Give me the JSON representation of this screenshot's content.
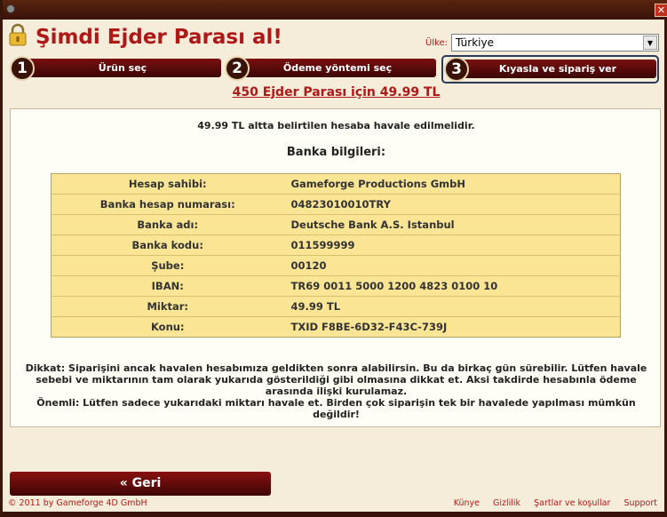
{
  "header": {
    "title": "Şimdi Ejder Parası al!",
    "country_label": "Ülke:",
    "country_value": "Türkiye"
  },
  "steps": [
    {
      "num": "1",
      "label": "Ürün seç"
    },
    {
      "num": "2",
      "label": "Ödeme yöntemi seç"
    },
    {
      "num": "3",
      "label": "Kıyasla ve sipariş ver"
    }
  ],
  "headline": "450 Ejder Parası için 49.99 TL",
  "panel": {
    "info": "49.99 TL altta belirtilen hesaba havale edilmelidir.",
    "bank_title": "Banka bilgileri:",
    "rows": [
      {
        "key": "Hesap sahibi:",
        "value": "Gameforge Productions GmbH"
      },
      {
        "key": "Banka hesap numarası:",
        "value": "04823010010TRY"
      },
      {
        "key": "Banka adı:",
        "value": "Deutsche Bank A.S. Istanbul"
      },
      {
        "key": "Banka kodu:",
        "value": "011599999"
      },
      {
        "key": "Şube:",
        "value": "00120"
      },
      {
        "key": "IBAN:",
        "value": "TR69 0011 5000 1200 4823 0100 10"
      },
      {
        "key": "Miktar:",
        "value": "49.99 TL"
      },
      {
        "key": "Konu:",
        "value": "TXID F8BE-6D32-F43C-739J"
      }
    ],
    "notice_1": "Dikkat: Siparişini ancak havalen hesabımıza geldikten sonra alabilirsin. Bu da birkaç gün sürebilir. Lütfen havale sebebi ve miktarının tam olarak yukarıda gösterildiği gibi olmasına dikkat et. Aksi takdirde hesabınla ödeme arasında ilişki kurulamaz.",
    "notice_2": "Önemli: Lütfen sadece yukarıdaki miktarı havale et. Birden çok siparişin tek bir havalede yapılması mümkün değildir!"
  },
  "back_label": "« Geri",
  "footer": {
    "copyright": "© 2011 by Gameforge 4D GmbH",
    "links": [
      "Künye",
      "Gizlilik",
      "Şartlar ve koşullar",
      "Support"
    ]
  }
}
